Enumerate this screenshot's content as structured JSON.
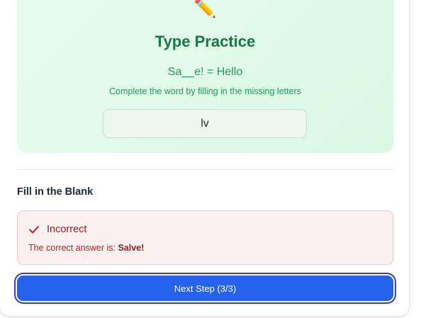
{
  "practice": {
    "icon": "pencil-icon",
    "icon_glyph": "✏️",
    "title": "Type Practice",
    "prompt": "Sa__e! = Hello",
    "hint": "Complete the word by filling in the missing letters",
    "input_value": "lv"
  },
  "section": {
    "title": "Fill in the Blank"
  },
  "feedback": {
    "icon": "check-icon",
    "status": "Incorrect",
    "line_prefix": "The correct answer is: ",
    "correct_answer": "Salve!"
  },
  "next_button": {
    "label": "Next Step (3/3)"
  },
  "colors": {
    "success_green": "#157a3e",
    "error_red": "#9b1c1c",
    "primary_blue": "#2563eb"
  }
}
